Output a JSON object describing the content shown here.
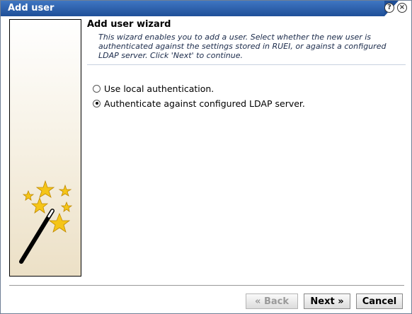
{
  "window": {
    "title": "Add user",
    "help_icon": "help-icon",
    "close_icon": "close-icon"
  },
  "wizard": {
    "heading": "Add user wizard",
    "description": "This wizard enables you to add a user. Select whether the new user is authenticated against the settings stored in RUEI, or against a configured LDAP server. Click 'Next' to continue.",
    "art_icon": "magic-wand-stars-icon"
  },
  "options": [
    {
      "label": "Use local authentication.",
      "selected": false
    },
    {
      "label": "Authenticate against configured LDAP server.",
      "selected": true
    }
  ],
  "buttons": {
    "back": "« Back",
    "next": "Next »",
    "cancel": "Cancel"
  },
  "colors": {
    "title_bar": "#2a5ca8",
    "star_fill": "#f5c518"
  }
}
